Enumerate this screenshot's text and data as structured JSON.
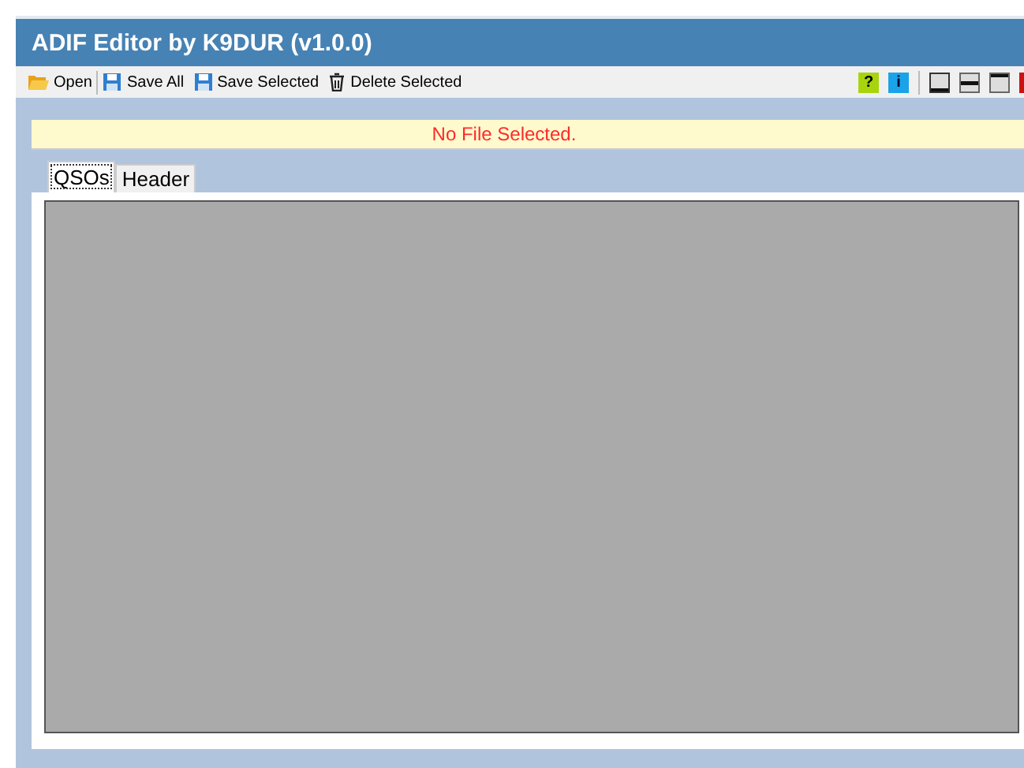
{
  "window": {
    "title": "ADIF Editor by K9DUR (v1.0.0)"
  },
  "toolbar": {
    "left": [
      {
        "kind": "open",
        "label": "Open"
      },
      {
        "kind": "save",
        "label": "Save All"
      },
      {
        "kind": "save",
        "label": "Save Selected"
      },
      {
        "kind": "delete",
        "label": "Delete Selected"
      }
    ],
    "right": [
      {
        "kind": "help",
        "label": "?"
      },
      {
        "kind": "info",
        "label": "i"
      },
      {
        "kind": "layout-bottom"
      },
      {
        "kind": "layout-middle"
      },
      {
        "kind": "layout-top"
      },
      {
        "kind": "red"
      }
    ]
  },
  "status_message": "No File Selected.",
  "tabs": [
    {
      "label": "QSOs",
      "selected": true
    },
    {
      "label": "Header",
      "selected": false
    }
  ]
}
